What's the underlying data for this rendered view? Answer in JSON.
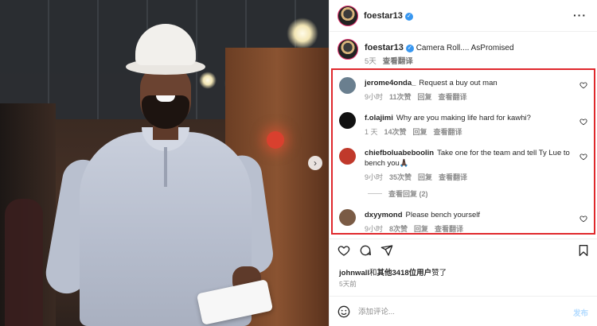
{
  "post": {
    "username": "foestar13",
    "caption": "Camera Roll.... AsPromised",
    "caption_time": "5天",
    "translate": "查看翻译"
  },
  "comments": [
    {
      "user": "jerome4onda_",
      "text": "Request a buy out man",
      "time": "9小时",
      "likes": "11次赞",
      "reply": "回复",
      "translate": "查看翻译",
      "avatar_color": "#6a7f8f"
    },
    {
      "user": "f.olajimi",
      "text": "Why are you making life hard for kawhi?",
      "time": "1 天",
      "likes": "14次赞",
      "reply": "回复",
      "translate": "查看翻译",
      "avatar_color": "#111111"
    },
    {
      "user": "chiefboluabeboolin",
      "text": "Take one for the team and tell Ty Lue to bench you🙏🏿",
      "time": "9小时",
      "likes": "35次赞",
      "reply": "回复",
      "translate": "查看翻译",
      "avatar_color": "#c0392b",
      "view_replies": "查看回复 (2)"
    },
    {
      "user": "dxyymond",
      "text": "Please bench yourself",
      "time": "9小时",
      "likes": "8次赞",
      "reply": "回复",
      "translate": "查看翻译",
      "avatar_color": "#7a5b45"
    }
  ],
  "likes": {
    "user": "johnwall",
    "connector": "和",
    "others": "其他3418位用户",
    "suffix": "赞了"
  },
  "post_date": "5天前",
  "composer": {
    "placeholder": "添加评论...",
    "publish_label": "发布"
  },
  "colors": {
    "highlight_border": "#e0282c",
    "verified": "#3897f0",
    "publish_disabled": "#b3dbff"
  },
  "icons": [
    "more-icon",
    "verified-icon",
    "heart-icon",
    "comment-icon",
    "share-icon",
    "bookmark-icon",
    "emoji-icon",
    "carousel-next-icon"
  ]
}
